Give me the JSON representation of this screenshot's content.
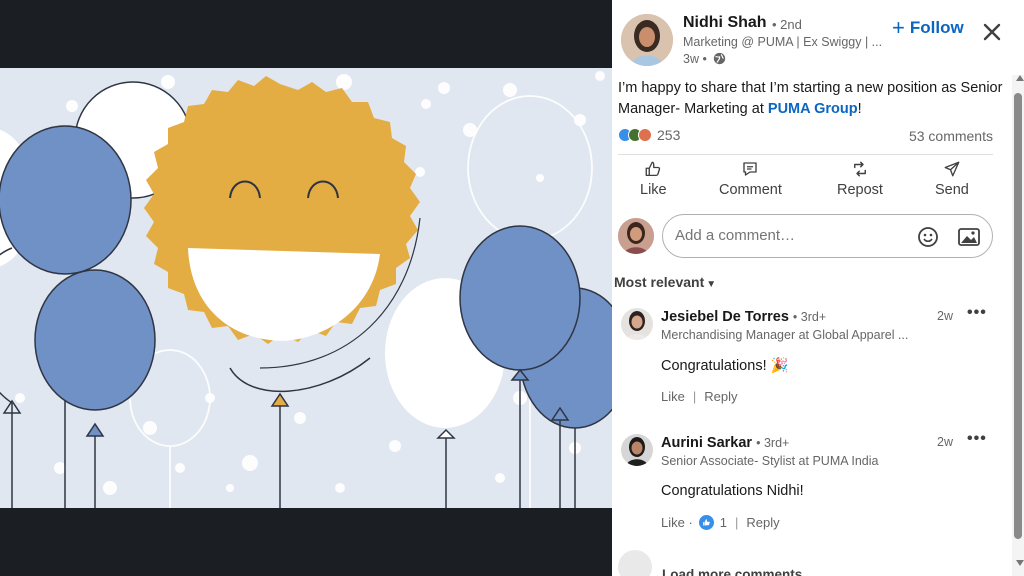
{
  "post": {
    "author_name": "Nidhi Shah",
    "author_degree": "• 2nd",
    "author_headline": "Marketing @ PUMA | Ex Swiggy | ...",
    "time": "3w •",
    "follow_label": "Follow",
    "text_before": "I’m happy to share that I’m starting a new position as Senior Manager- Marketing at ",
    "text_link": "PUMA Group",
    "text_after": "!",
    "reaction_count": "253",
    "comments_count": "53 comments"
  },
  "actions": {
    "like": "Like",
    "comment": "Comment",
    "repost": "Repost",
    "send": "Send"
  },
  "comment_box": {
    "placeholder": "Add a comment…"
  },
  "sort": {
    "label": "Most relevant"
  },
  "comments": [
    {
      "name": "Jesiebel De Torres",
      "degree": "• 3rd+",
      "headline": "Merchandising Manager at Global Apparel ...",
      "time": "2w",
      "text": "Congratulations! 🎉",
      "like_label": "Like",
      "reply_label": "Reply"
    },
    {
      "name": "Aurini Sarkar",
      "degree": "• 3rd+",
      "headline": "Senior Associate- Stylist at PUMA India",
      "time": "2w",
      "text": "Congratulations Nidhi!",
      "like_label": "Like ·",
      "like_count": "1",
      "reply_label": "Reply"
    }
  ],
  "load_more": "Load more comments",
  "colors": {
    "accent": "#0a66c2",
    "smiley": "#e3ad43",
    "balloon_blue": "#6f91c6",
    "art_background": "#e1e7f0"
  },
  "icons": {
    "close": "close-icon",
    "globe": "globe-icon",
    "like": "thumbs-up-icon",
    "comment": "speech-bubble-icon",
    "repost": "repost-icon",
    "send": "send-icon",
    "emoji": "emoji-icon",
    "image": "image-icon"
  }
}
